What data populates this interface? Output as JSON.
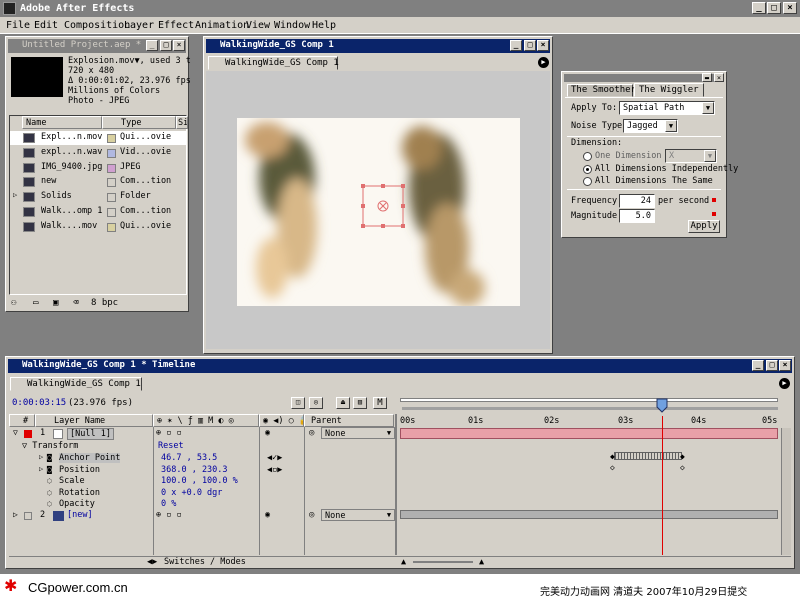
{
  "app": {
    "title": "Adobe After Effects"
  },
  "window_buttons": {
    "min": "_",
    "max": "□",
    "close": "×"
  },
  "menu": [
    "File",
    "Edit",
    "Composition",
    "Layer",
    "Effect",
    "Animation",
    "View",
    "Window",
    "Help"
  ],
  "project": {
    "title": "Untitled Project.aep *",
    "info": [
      "Explosion.mov▼, used 3 t",
      "720 x 480",
      "Δ 0:00:01:02, 23.976 fps",
      "Millions of Colors",
      "Photo - JPEG"
    ],
    "columns": [
      "Name",
      "Type",
      "Si"
    ],
    "items": [
      {
        "name": "Expl...n.mov",
        "type": "Qui...ovie",
        "color": "#d8d0a0",
        "selected": true
      },
      {
        "name": "expl...n.wav",
        "type": "Vid...ovie",
        "color": "#b0b8e0",
        "selected": false
      },
      {
        "name": "IMG_9400.jpg",
        "type": "JPEG",
        "color": "#d0a0d0",
        "selected": false
      },
      {
        "name": "new",
        "type": "Com...tion",
        "color": "#d4d0c8",
        "selected": false
      },
      {
        "name": "Solids",
        "type": "Folder",
        "color": "#d4d0c8",
        "selected": false
      },
      {
        "name": "Walk...omp 1",
        "type": "Com...tion",
        "color": "#d4d0c8",
        "selected": false
      },
      {
        "name": "Walk....mov",
        "type": "Qui...ovie",
        "color": "#d8d0a0",
        "selected": false
      }
    ],
    "bpc": "8 bpc"
  },
  "comp": {
    "title": "WalkingWide_GS Comp 1",
    "tab": "WalkingWide_GS Comp 1"
  },
  "wiggler": {
    "tabs": [
      "The Smoother",
      "The Wiggler"
    ],
    "apply_to_label": "Apply To:",
    "apply_to_value": "Spatial Path",
    "noise_type_label": "Noise Type:",
    "noise_type_value": "Jagged",
    "dimension_label": "Dimension:",
    "one_dimension": "One Dimension",
    "one_dimension_axis": "X",
    "all_independently": "All Dimensions Independently",
    "all_same": "All Dimensions The Same",
    "frequency_label": "Frequency:",
    "frequency_value": "24",
    "frequency_unit": "per second",
    "magnitude_label": "Magnitude:",
    "magnitude_value": "5.0",
    "apply_button": "Apply"
  },
  "timeline": {
    "title": "WalkingWide_GS Comp 1 * Timeline",
    "tab": "WalkingWide_GS Comp 1",
    "timecode": "0:00:03:15",
    "fps": "(23.976 fps)",
    "col_num": "#",
    "col_layer_name": "Layer Name",
    "col_parent": "Parent",
    "ruler": [
      "00s",
      "01s",
      "02s",
      "03s",
      "04s",
      "05s"
    ],
    "layers": [
      {
        "num": "1",
        "name": "[Null 1]",
        "parent": "None"
      },
      {
        "num": "2",
        "name": "[new]",
        "parent": "None"
      }
    ],
    "transform": {
      "label": "Transform",
      "reset": "Reset"
    },
    "props": [
      {
        "name": "Anchor Point",
        "value": "46.7 , 53.5"
      },
      {
        "name": "Position",
        "value": "368.0 , 230.3"
      },
      {
        "name": "Scale",
        "value": "100.0 , 100.0 %"
      },
      {
        "name": "Rotation",
        "value": "0 x +0.0 dgr"
      },
      {
        "name": "Opacity",
        "value": "0 %"
      }
    ],
    "switches_modes": "Switches / Modes",
    "m_label": "M"
  },
  "watermark": {
    "left": "CGpower.com.cn",
    "right": "完美动力动画网 清道夫 2007年10月29日提交"
  },
  "colors": {
    "title_active": "#0a246a",
    "layer_bar": "#e8a0a8",
    "playhead": "#e00000"
  }
}
